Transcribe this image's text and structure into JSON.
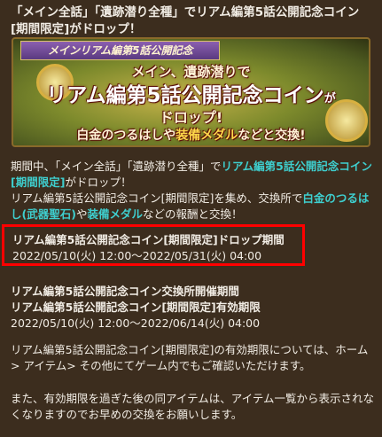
{
  "title": "「メイン全話」「遺跡潜り全種」でリアム編第5話公開記念コイン[期間限定]がドロップ！",
  "banner": {
    "ribbon": "メインリアム編第5話公開記念",
    "line1": "メイン、遺跡潜りで",
    "line2": "リアム編第5話公開記念コイン",
    "line2_suffix": "が",
    "line3": "ドロップ!",
    "line4_a": "白金のつるはしや",
    "line4_b": "装備メダル",
    "line4_c": "などと交換!"
  },
  "intro": {
    "p1_a": "期間中、「メイン全話」「遺跡潜り全種」で",
    "p1_link": "リアム編第5話公開記念コイン[期間限定]",
    "p1_b": "がドロップ！",
    "p2_a": "リアム編第5話公開記念コイン[期間限定]を集め、交換所で",
    "p2_link1": "白金のつるはし(武器聖石)",
    "p2_b": "や",
    "p2_link2": "装備メダル",
    "p2_c": "などの報酬と交換！"
  },
  "drop_period": {
    "heading": "リアム編第5話公開記念コイン[期間限定]ドロップ期間",
    "dates": "2022/05/10(火) 12:00～2022/05/31(火) 04:00"
  },
  "exchange": {
    "heading1": "リアム編第5話公開記念コイン交換所開催期間",
    "heading2": "リアム編第5話公開記念コイン[期間限定]有効期限",
    "dates": "2022/05/10(火) 12:00～2022/06/14(火) 04:00"
  },
  "note1": "リアム編第5話公開記念コイン[期間限定]の有効期限については、ホーム> アイテム> その他にてゲーム内でもご確認いただけます。",
  "note2": "また、有効期限を過ぎた後の同アイテムは、アイテム一覧から表示されなくなりますのでお早めの交換をお願いします。"
}
